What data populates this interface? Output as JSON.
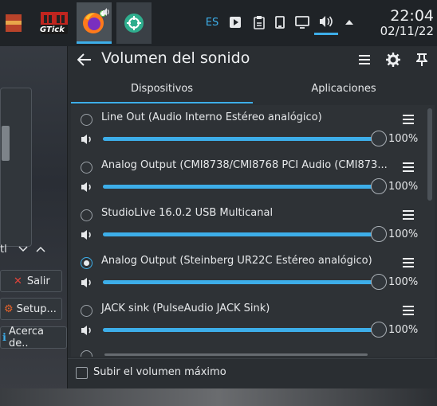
{
  "taskbar": {
    "apps": [
      {
        "name": "unknown-app-icon"
      },
      {
        "name": "gtick-app",
        "label": "GTick"
      },
      {
        "name": "firefox-icon"
      },
      {
        "name": "green-app-icon"
      }
    ],
    "keyboard_layout": "ES",
    "clock": {
      "time": "22:04",
      "date": "02/11/22"
    },
    "accent_color": "#3daee9"
  },
  "background_window": {
    "buttons": [
      {
        "label": "Salir",
        "icon": "x-icon"
      },
      {
        "label": "Setup...",
        "icon": "setup-icon"
      },
      {
        "label": "Acerca de..",
        "icon": "info-icon"
      }
    ],
    "fragment_text": "tl"
  },
  "popup": {
    "title": "Volumen del sonido",
    "tabs": [
      {
        "label": "Dispositivos",
        "active": true
      },
      {
        "label": "Aplicaciones",
        "active": false
      }
    ],
    "devices": [
      {
        "name": "Line Out (Audio Interno Estéreo analógico)",
        "volume": "100%",
        "level": 1.0,
        "selected": false
      },
      {
        "name": "Analog Output (CMI8738/CMI8768 PCI Audio (CMI873...",
        "volume": "100%",
        "level": 1.0,
        "selected": false
      },
      {
        "name": "StudioLive 16.0.2 USB Multicanal",
        "volume": "100%",
        "level": 1.0,
        "selected": false
      },
      {
        "name": "Analog Output (Steinberg UR22C Estéreo analógico)",
        "volume": "100%",
        "level": 1.0,
        "selected": true
      },
      {
        "name": "JACK sink (PulseAudio JACK Sink)",
        "volume": "100%",
        "level": 1.0,
        "selected": false
      }
    ],
    "raise_max_label": "Subir el volumen máximo"
  }
}
